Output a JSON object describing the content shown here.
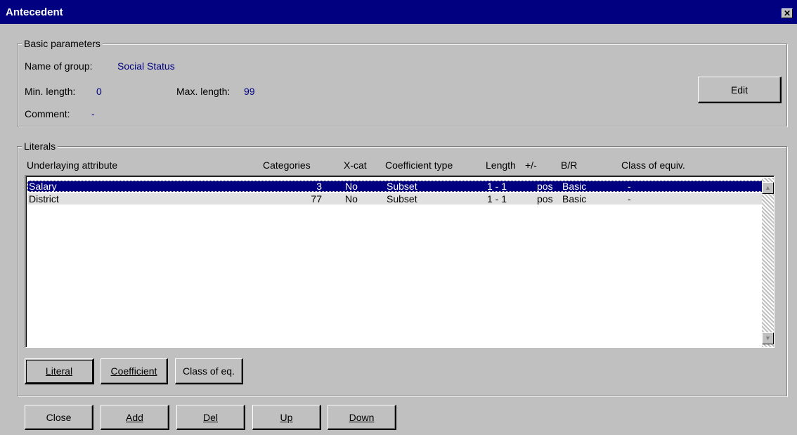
{
  "window": {
    "title": "Antecedent",
    "close_glyph": "✕"
  },
  "basic": {
    "legend": "Basic parameters",
    "name_label": "Name of group:",
    "name_value": "Social Status",
    "min_label": "Min. length:",
    "min_value": "0",
    "max_label": "Max. length:",
    "max_value": "99",
    "comment_label": "Comment:",
    "comment_value": "-",
    "edit_button": "Edit"
  },
  "literals": {
    "legend": "Literals",
    "columns": [
      "Underlaying attribute",
      "Categories",
      "X-cat",
      "Coefficient type",
      "Length",
      "+/-",
      "B/R",
      "Class of equiv."
    ],
    "rows": [
      {
        "attribute": "Salary",
        "categories": "3",
        "xcat": "No",
        "coef": "Subset",
        "length": "1 - 1",
        "sign": "pos",
        "br": "Basic",
        "equiv": "-",
        "selected": true
      },
      {
        "attribute": "District",
        "categories": "77",
        "xcat": "No",
        "coef": "Subset",
        "length": "1 - 1",
        "sign": "pos",
        "br": "Basic",
        "equiv": "-",
        "selected": false
      }
    ],
    "buttons": {
      "literal": "Literal",
      "coefficient": "Coefficient",
      "class_of_eq": "Class of eq."
    }
  },
  "footer": {
    "close": "Close",
    "add": "Add",
    "del": "Del",
    "up": "Up",
    "down": "Down"
  },
  "colors": {
    "titlebar": "#000080",
    "face": "#c0c0c0",
    "value_text": "#000080"
  }
}
